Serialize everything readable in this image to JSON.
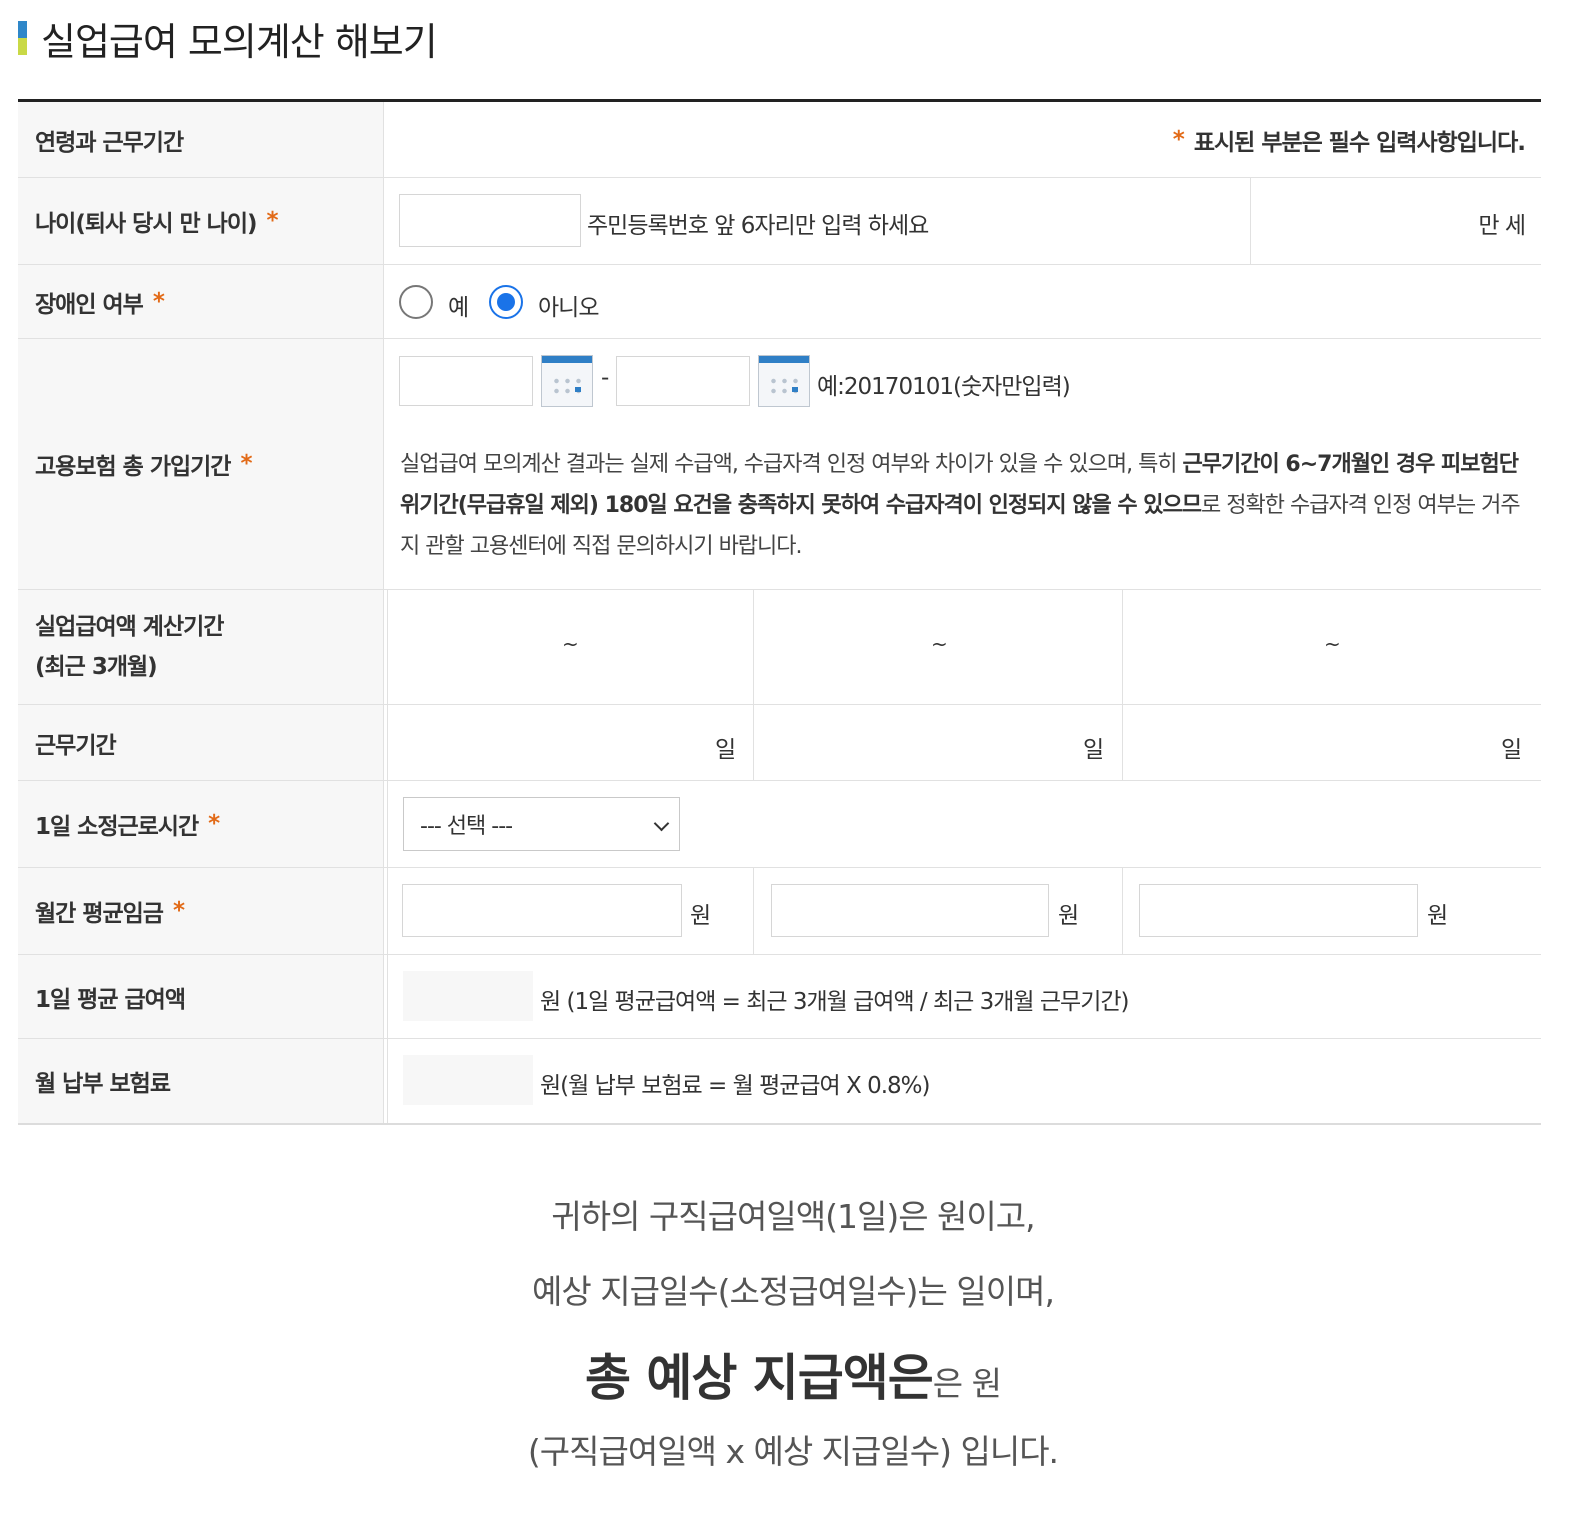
{
  "page_title": "실업급여 모의계산 해보기",
  "header_row": {
    "label": "연령과 근무기간",
    "required_mark": "*",
    "required_note": "표시된 부분은 필수 입력사항입니다."
  },
  "age": {
    "label": "나이(퇴사 당시 만 나이)",
    "required_mark": "*",
    "value": "",
    "hint": "주민등록번호 앞 6자리만 입력 하세요",
    "result_text": "만 세"
  },
  "disability": {
    "label": "장애인 여부",
    "required_mark": "*",
    "options": [
      {
        "label": "예",
        "selected": false
      },
      {
        "label": "아니오",
        "selected": true
      }
    ]
  },
  "insurance_period": {
    "label": "고용보험 총 가입기간",
    "required_mark": "*",
    "start_value": "",
    "end_value": "",
    "separator": "-",
    "example": "예:20170101(숫자만입력)",
    "notice_part1": "실업급여 모의계산 결과는 실제 수급액, 수급자격 인정 여부와 차이가 있을 수 있으며, 특히 ",
    "notice_bold": "근무기간이 6~7개월인 경우 피보험단위기간(무급휴일 제외) 180일 요건을 충족하지 못하여 수급자격이 인정되지 않을 수 있으므",
    "notice_part2": "로 정확한 수급자격 인정 여부는 거주지 관할 고용센터에 직접 문의하시기 바랍니다."
  },
  "calc_period": {
    "label_line1": "실업급여액 계산기간",
    "label_line2": "(최근 3개월)",
    "cols": [
      "~",
      "~",
      "~"
    ]
  },
  "work_days": {
    "label": "근무기간",
    "unit": "일",
    "cols": [
      "일",
      "일",
      "일"
    ]
  },
  "daily_hours": {
    "label": "1일 소정근로시간",
    "required_mark": "*",
    "selected": "--- 선택 ---"
  },
  "monthly_wage": {
    "label": "월간 평균임금",
    "required_mark": "*",
    "values": [
      "",
      "",
      ""
    ],
    "unit": "원"
  },
  "daily_avg": {
    "label": "1일 평균 급여액",
    "value": "",
    "formula": "원 (1일 평균급여액 = 최근 3개월 급여액 / 최근 3개월 근무기간)"
  },
  "monthly_premium": {
    "label": "월 납부 보험료",
    "value": "",
    "formula": "원(월 납부 보험료 = 월 평균급여 X 0.8%)"
  },
  "result": {
    "line1": "귀하의 구직급여일액(1일)은 원이고,",
    "line2": "예상 지급일수(소정급여일수)는 일이며,",
    "line3_bold": "총 예상 지급액은",
    "line3_rest": "은 원",
    "line4": "(구직급여일액 x 예상 지급일수) 입니다."
  }
}
